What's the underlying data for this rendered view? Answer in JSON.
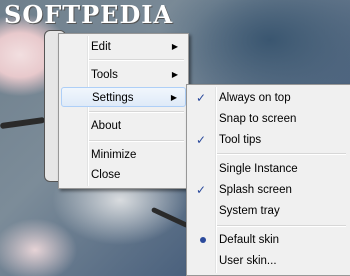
{
  "watermark": "SOFTPEDIA",
  "main_menu": {
    "items": [
      {
        "label": "Edit",
        "submenu": true
      },
      {
        "label": "Tools",
        "submenu": true
      },
      {
        "label": "Settings",
        "submenu": true,
        "highlighted": true
      },
      {
        "label": "About"
      },
      {
        "label": "Minimize"
      },
      {
        "label": "Close"
      }
    ]
  },
  "settings_menu": {
    "items": [
      {
        "label": "Always on top",
        "checked": true
      },
      {
        "label": "Snap to screen",
        "checked": false
      },
      {
        "label": "Tool tips",
        "checked": true
      },
      {
        "label": "Single Instance",
        "checked": false
      },
      {
        "label": "Splash screen",
        "checked": true
      },
      {
        "label": "System tray",
        "checked": false
      },
      {
        "label": "Default skin",
        "selected": true
      },
      {
        "label": "User skin...",
        "selected": false
      }
    ]
  },
  "icons": {
    "submenu_arrow": "▶",
    "check": "✓"
  }
}
